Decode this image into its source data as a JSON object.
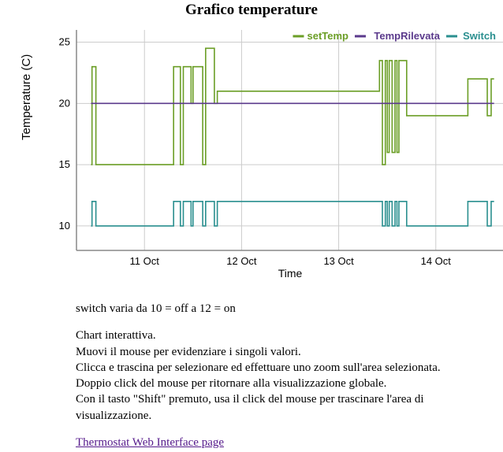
{
  "chart_data": {
    "type": "line",
    "title": "Grafico temperature",
    "xlabel": "Time",
    "ylabel": "Temperature (C)",
    "ylim": [
      8,
      26
    ],
    "yticks": [
      10,
      15,
      20,
      25
    ],
    "xticks": [
      "11 Oct",
      "12 Oct",
      "13 Oct",
      "14 Oct"
    ],
    "legend_position": "top-right",
    "series": [
      {
        "name": "setTemp",
        "color": "#6b9e26",
        "x": [
          10.45,
          10.46,
          10.48,
          10.5,
          10.52,
          11.3,
          11.32,
          11.37,
          11.4,
          11.45,
          11.48,
          11.5,
          11.55,
          11.6,
          11.63,
          11.7,
          11.72,
          11.75,
          13.0,
          13.39,
          13.42,
          13.45,
          13.48,
          13.5,
          13.52,
          13.55,
          13.58,
          13.6,
          13.62,
          13.65,
          13.7,
          14.0,
          14.3,
          14.33,
          14.5,
          14.53,
          14.57,
          14.6
        ],
        "y": [
          15,
          23,
          23,
          15,
          15,
          23,
          23,
          15,
          23,
          23,
          20,
          23,
          23,
          15,
          24.5,
          24.5,
          20,
          21,
          21,
          21,
          23.5,
          15,
          23.5,
          16,
          23.5,
          16,
          23.5,
          16,
          23.5,
          23.5,
          19,
          19,
          19,
          22,
          22,
          19,
          22,
          22
        ]
      },
      {
        "name": "TempRilevata",
        "color": "#5b3a8c",
        "x": [
          10.45,
          14.6
        ],
        "y": [
          20,
          20
        ]
      },
      {
        "name": "Switch",
        "color": "#2a8f8f",
        "x": [
          10.45,
          10.46,
          10.48,
          10.5,
          10.52,
          11.3,
          11.32,
          11.37,
          11.4,
          11.45,
          11.48,
          11.5,
          11.55,
          11.6,
          11.63,
          11.7,
          11.72,
          11.75,
          13.0,
          13.39,
          13.42,
          13.45,
          13.48,
          13.5,
          13.52,
          13.55,
          13.58,
          13.6,
          13.62,
          13.65,
          13.7,
          14.0,
          14.3,
          14.33,
          14.5,
          14.53,
          14.57,
          14.6
        ],
        "y": [
          10,
          12,
          12,
          10,
          10,
          12,
          12,
          10,
          12,
          12,
          10,
          12,
          12,
          10,
          12,
          12,
          10,
          12,
          12,
          12,
          12,
          10,
          12,
          10,
          12,
          10,
          12,
          10,
          12,
          12,
          10,
          10,
          10,
          12,
          12,
          10,
          12,
          12
        ]
      }
    ]
  },
  "notes": {
    "line1": "switch varia da 10 = off a 12 = on",
    "para": "Chart interattiva.\nMuovi il mouse per evidenziare i singoli valori.\nClicca e trascina per selezionare ed effettuare uno zoom sull'area selezionata.\nDoppio click del mouse per ritornare alla visualizzazione globale.\nCon il tasto \"Shift\" premuto, usa il click del mouse per trascinare l'area di visualizzazione.",
    "link_text": "Thermostat Web Interface page"
  }
}
